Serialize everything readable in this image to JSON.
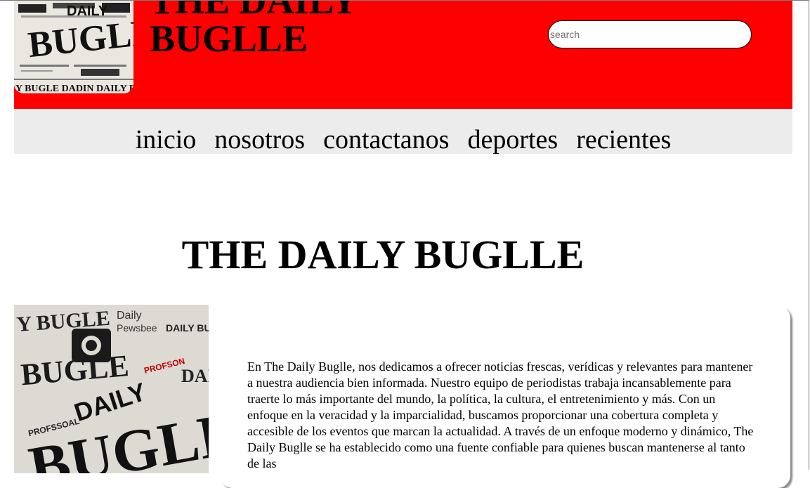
{
  "header": {
    "site_title": "THE DAILY BUGLLE",
    "logo_alt": "DAILY BUGLLE",
    "search_placeholder": "search"
  },
  "nav": {
    "items": [
      {
        "label": "inicio"
      },
      {
        "label": "nosotros"
      },
      {
        "label": "contactanos"
      },
      {
        "label": "deportes"
      },
      {
        "label": "recientes"
      }
    ]
  },
  "main": {
    "title": "THE DAILY BUGLLE",
    "hero_alt": "DAILY BUGLLE",
    "about_text": "En The Daily Buglle, nos dedicamos a ofrecer noticias frescas, verídicas y relevantes para mantener a nuestra audiencia bien informada. Nuestro equipo de periodistas trabaja incansablemente para traerte lo más importante del mundo, la política, la cultura, el entretenimiento y más. Con un enfoque en la veracidad y la imparcialidad, buscamos proporcionar una cobertura completa y accesible de los eventos que marcan la actualidad. A través de un enfoque moderno y dinámico, The Daily Buglle se ha establecido como una fuente confiable para quienes buscan mantenerse al tanto de las"
  },
  "colors": {
    "header_bg": "#ff0000",
    "nav_bg": "#ececec",
    "text": "#000000"
  }
}
